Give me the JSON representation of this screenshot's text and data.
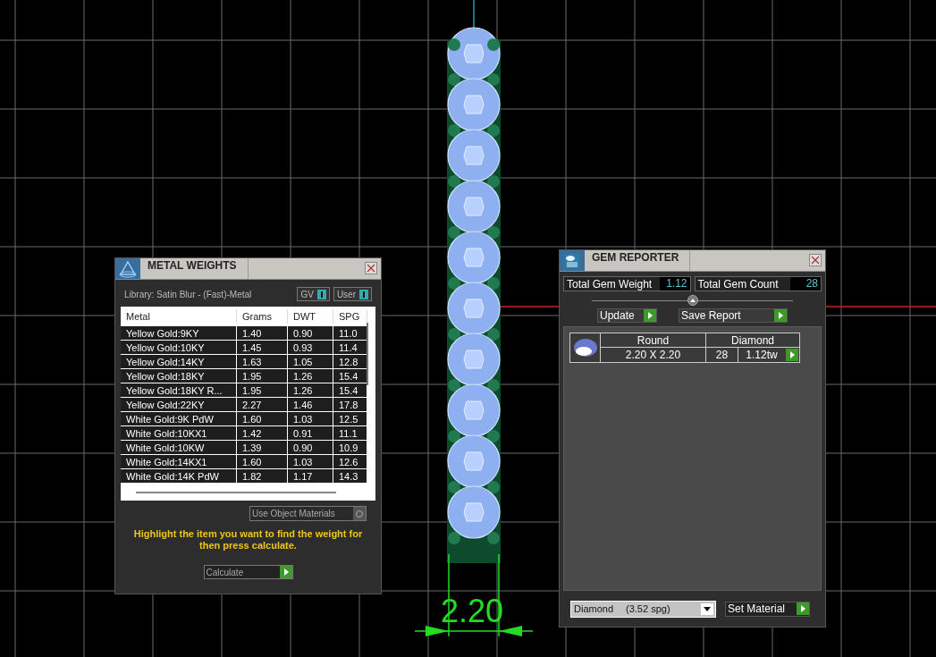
{
  "viewport": {
    "dimension": "2.20"
  },
  "metal_weights": {
    "title": "METAL WEIGHTS",
    "library": "Library: Satin Blur - (Fast)-Metal",
    "toggles": [
      {
        "label": "GV",
        "on": true
      },
      {
        "label": "User",
        "on": true
      }
    ],
    "table": {
      "columns": [
        "Metal",
        "Grams",
        "DWT",
        "SPG"
      ],
      "rows": [
        [
          "Yellow Gold:9KY",
          "1.40",
          "0.90",
          "11.0"
        ],
        [
          "Yellow Gold:10KY",
          "1.45",
          "0.93",
          "11.4"
        ],
        [
          "Yellow Gold:14KY",
          "1.63",
          "1.05",
          "12.8"
        ],
        [
          "Yellow Gold:18KY",
          "1.95",
          "1.26",
          "15.4"
        ],
        [
          "Yellow Gold:18KY R...",
          "1.95",
          "1.26",
          "15.4"
        ],
        [
          "Yellow Gold:22KY",
          "2.27",
          "1.46",
          "17.8"
        ],
        [
          "White Gold:9K PdW",
          "1.60",
          "1.03",
          "12.5"
        ],
        [
          "White Gold:10KX1",
          "1.42",
          "0.91",
          "11.1"
        ],
        [
          "White Gold:10KW",
          "1.39",
          "0.90",
          "10.9"
        ],
        [
          "White Gold:14KX1",
          "1.60",
          "1.03",
          "12.6"
        ],
        [
          "White Gold:14K PdW",
          "1.82",
          "1.17",
          "14.3"
        ]
      ]
    },
    "use_object_materials": {
      "label": "Use Object Materials",
      "checked": false
    },
    "hint": "Highlight the item you want to find the weight for then press calculate.",
    "calculate_button": "Calculate"
  },
  "gem_reporter": {
    "title": "GEM REPORTER",
    "total_gem_weight": {
      "label": "Total Gem Weight",
      "value": "1.12"
    },
    "total_gem_count": {
      "label": "Total Gem Count",
      "value": "28"
    },
    "buttons": [
      "Update",
      "Save Report"
    ],
    "gems": [
      {
        "shape": "Round",
        "material": "Diamond",
        "size": "2.20 X 2.20",
        "count": "28",
        "weight": "1.12tw"
      }
    ],
    "material_select": {
      "value": "Diamond",
      "spg": "(3.52 spg)"
    },
    "set_material_button": "Set Material"
  }
}
